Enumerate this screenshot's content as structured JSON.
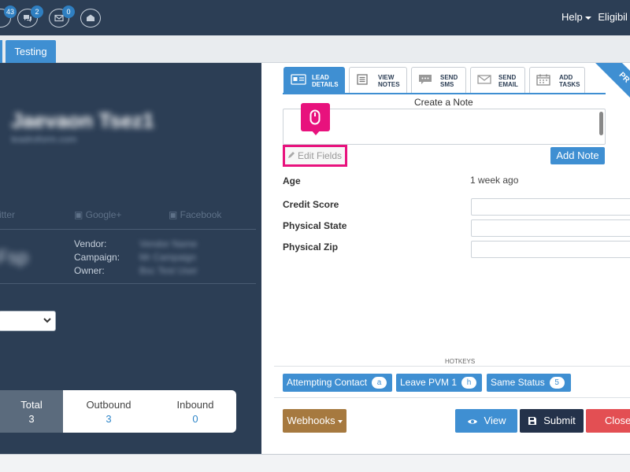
{
  "navbar": {
    "icons": [
      {
        "name": "chart-icon",
        "badge": "43"
      },
      {
        "name": "chat-icon",
        "badge": "2"
      },
      {
        "name": "mail-icon",
        "badge": "0"
      },
      {
        "name": "envelope-open-icon",
        "badge": ""
      }
    ],
    "help_label": "Help",
    "eligible_label": "Eligibil"
  },
  "tabs": {
    "active": "Testing"
  },
  "left": {
    "lead_name": "Jaevaon Tsez1",
    "lead_sub": "leadroform.com",
    "social": {
      "twitter": "itter",
      "google": "Google+",
      "facebook": "Facebook"
    },
    "meta": {
      "vendor_label": "Vendor:",
      "campaign_label": "Campaign:",
      "owner_label": "Owner:",
      "vendor_value": "Vendor Name",
      "campaign_value": "Mr Campaign",
      "owner_value": "Bsc Test User"
    },
    "stage_text": "Fsp",
    "stats": {
      "total_label": "Total",
      "total_value": "3",
      "outbound_label": "Outbound",
      "outbound_value": "3",
      "inbound_label": "Inbound",
      "inbound_value": "0"
    }
  },
  "right": {
    "subtabs": [
      {
        "line1": "LEAD",
        "line2": "DETAILS",
        "icon": "id-card-icon",
        "active": true
      },
      {
        "line1": "VIEW",
        "line2": "NOTES",
        "icon": "notes-icon",
        "active": false
      },
      {
        "line1": "SEND",
        "line2": "SMS",
        "icon": "sms-icon",
        "active": false
      },
      {
        "line1": "SEND",
        "line2": "EMAIL",
        "icon": "email-icon",
        "active": false
      },
      {
        "line1": "ADD",
        "line2": "TASKS",
        "icon": "calendar-icon",
        "active": false
      }
    ],
    "ribbon": "PR",
    "create_note": "Create a Note",
    "edit_fields": "Edit Fields",
    "add_note": "Add Note",
    "fields": [
      {
        "label": "Age",
        "value": "1 week ago"
      },
      {
        "label": "Credit Score",
        "value": ""
      },
      {
        "label": "Physical State",
        "value": ""
      },
      {
        "label": "Physical Zip",
        "value": ""
      }
    ],
    "hotkeys_title": "HOTKEYS",
    "hotkeys": [
      {
        "label": "Attempting Contact",
        "key": "a"
      },
      {
        "label": "Leave PVM 1",
        "key": "h"
      },
      {
        "label": "Same Status",
        "key": "5"
      }
    ],
    "buttons": {
      "webhooks": "Webhooks",
      "view": "View",
      "submit": "Submit",
      "close": "Close"
    }
  },
  "colors": {
    "navy": "#2c3e55",
    "accent": "#3f8fd2",
    "highlight": "#e8127d",
    "webhooks": "#a6793f",
    "close": "#e34f53"
  }
}
